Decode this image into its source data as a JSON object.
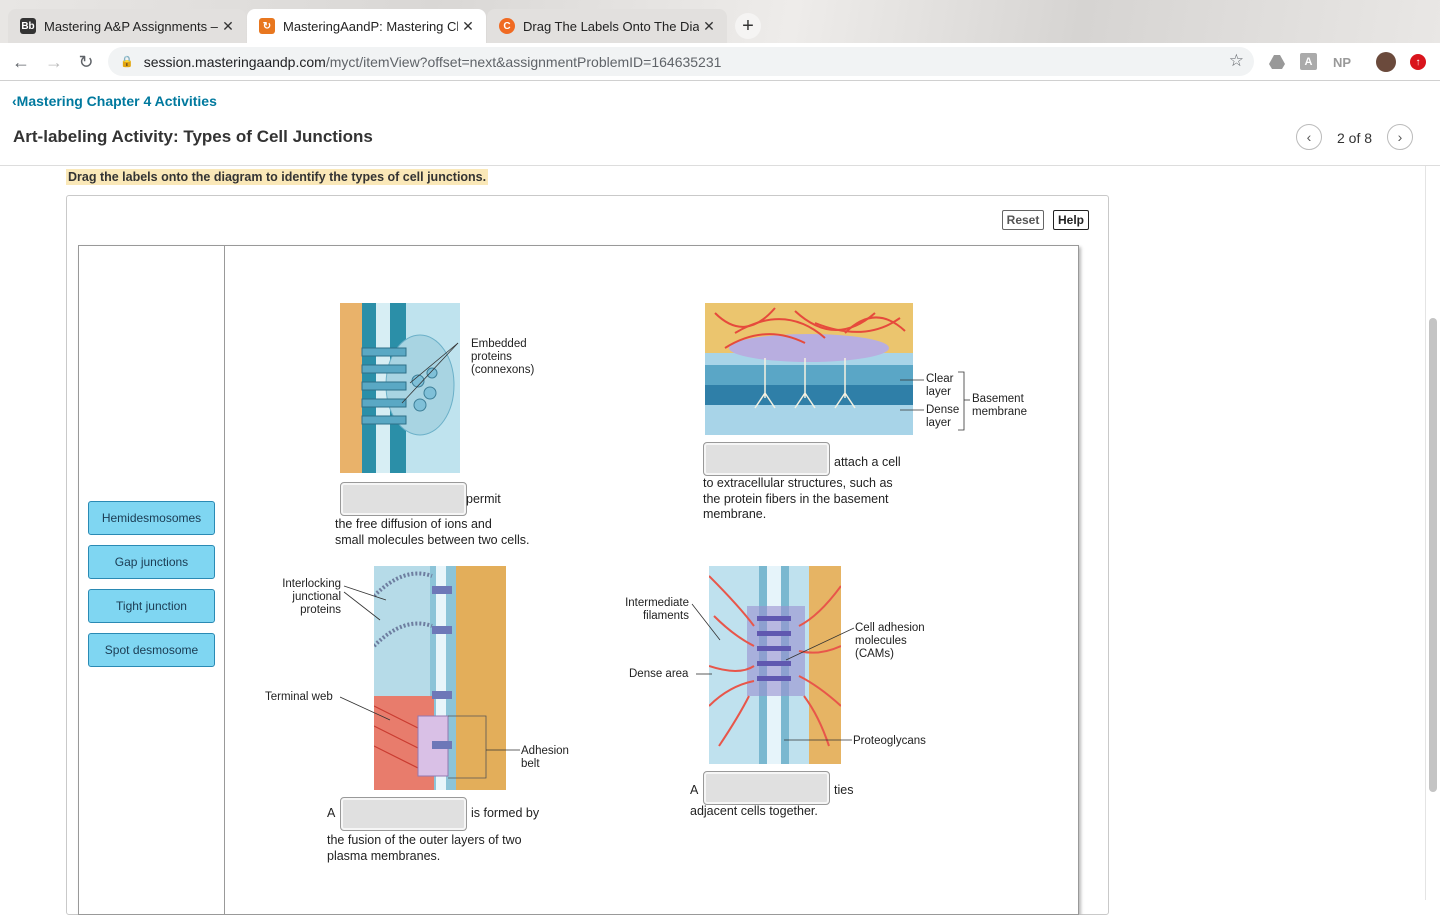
{
  "browser": {
    "tabs": [
      {
        "label": "Mastering A&P Assignments – ",
        "favicon": "Bb",
        "active": false
      },
      {
        "label": "MasteringAandP: Mastering Ch",
        "favicon": "mastering-icon",
        "active": true
      },
      {
        "label": "Drag The Labels Onto The Diag",
        "favicon": "C",
        "active": false
      }
    ],
    "url_host": "session.masteringaandp.com",
    "url_path": "/myct/itemView?offset=next&assignmentProblemID=164635231",
    "ext_np": "NP"
  },
  "page": {
    "back_link": "Mastering Chapter 4 Activities",
    "title": "Art-labeling Activity: Types of Cell Junctions",
    "pager": "2 of 8",
    "instruction": "Drag the labels onto the diagram to identify the types of cell junctions.",
    "reset": "Reset",
    "help": "Help"
  },
  "labels": [
    "Hemidesmosomes",
    "Gap junctions",
    "Tight junction",
    "Spot desmosome"
  ],
  "diagram": {
    "gap": {
      "after": "permit",
      "caption1": "the free diffusion of ions and",
      "caption2": "small molecules between two cells.",
      "annot1": "Embedded",
      "annot2": "proteins",
      "annot3": "(connexons)"
    },
    "hemi": {
      "after": "attach a cell",
      "caption1": "to extracellular structures, such as",
      "caption2": "the protein fibers in the basement",
      "caption3": "membrane.",
      "clear1": "Clear",
      "clear2": "layer",
      "dense1": "Dense",
      "dense2": "layer",
      "bm1": "Basement",
      "bm2": "membrane"
    },
    "tight": {
      "before": "A",
      "after": "is formed by",
      "caption1": "the fusion of the outer layers of two",
      "caption2": "plasma membranes.",
      "inter1": "Interlocking",
      "inter2": "junctional",
      "inter3": "proteins",
      "terminal": "Terminal web",
      "adh1": "Adhesion",
      "adh2": "belt"
    },
    "spot": {
      "before": "A",
      "after": "ties",
      "caption1": "adjacent cells together.",
      "int1": "Intermediate",
      "int2": "filaments",
      "dense": "Dense area",
      "cam1": "Cell adhesion",
      "cam2": "molecules",
      "cam3": "(CAMs)",
      "proteo": "Proteoglycans"
    }
  }
}
